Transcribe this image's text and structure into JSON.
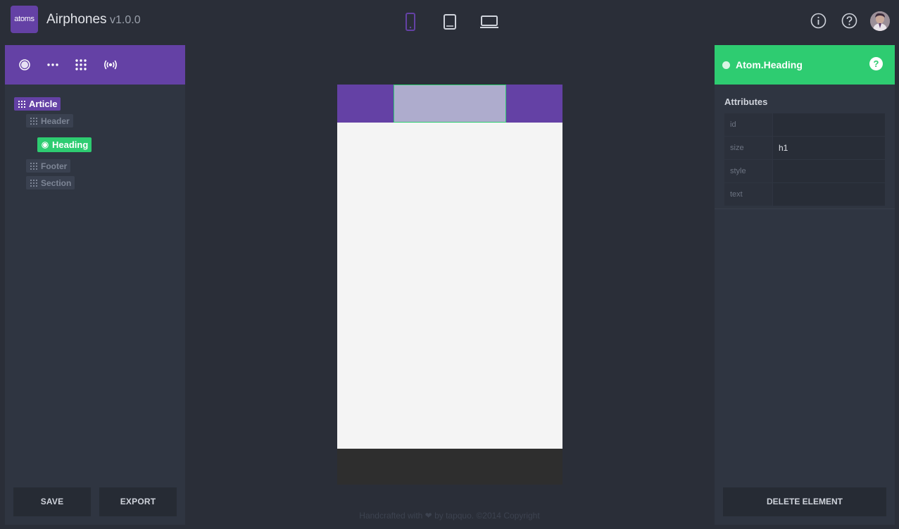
{
  "app": {
    "logo_text": "atoms",
    "title": "Airphones",
    "version": "v1.0.0"
  },
  "device_toggles": [
    {
      "name": "phone",
      "active": true
    },
    {
      "name": "tablet",
      "active": false
    },
    {
      "name": "laptop",
      "active": false
    }
  ],
  "header_icons": [
    "info-icon",
    "help-icon",
    "avatar"
  ],
  "left_toolbar": [
    "atom-icon",
    "molecule-icon",
    "organism-icon",
    "template-icon"
  ],
  "tree": {
    "root": "Article",
    "children": [
      "Header",
      "Heading",
      "Footer",
      "Section"
    ]
  },
  "left_buttons": {
    "save": "SAVE",
    "export": "EXPORT"
  },
  "inspector": {
    "title": "Atom.Heading",
    "help": "?",
    "section_title": "Attributes",
    "attributes": [
      {
        "key": "id",
        "value": ""
      },
      {
        "key": "size",
        "value": "h1"
      },
      {
        "key": "style",
        "value": ""
      },
      {
        "key": "text",
        "value": ""
      }
    ],
    "delete_label": "DELETE ELEMENT"
  },
  "footer_credits": "Handcrafted with ❤ by tapquo. ©2014 Copyright",
  "colors": {
    "accent": "#6441a5",
    "selected": "#2ecc71",
    "background": "#2a2e38",
    "panel": "#2f3541"
  }
}
